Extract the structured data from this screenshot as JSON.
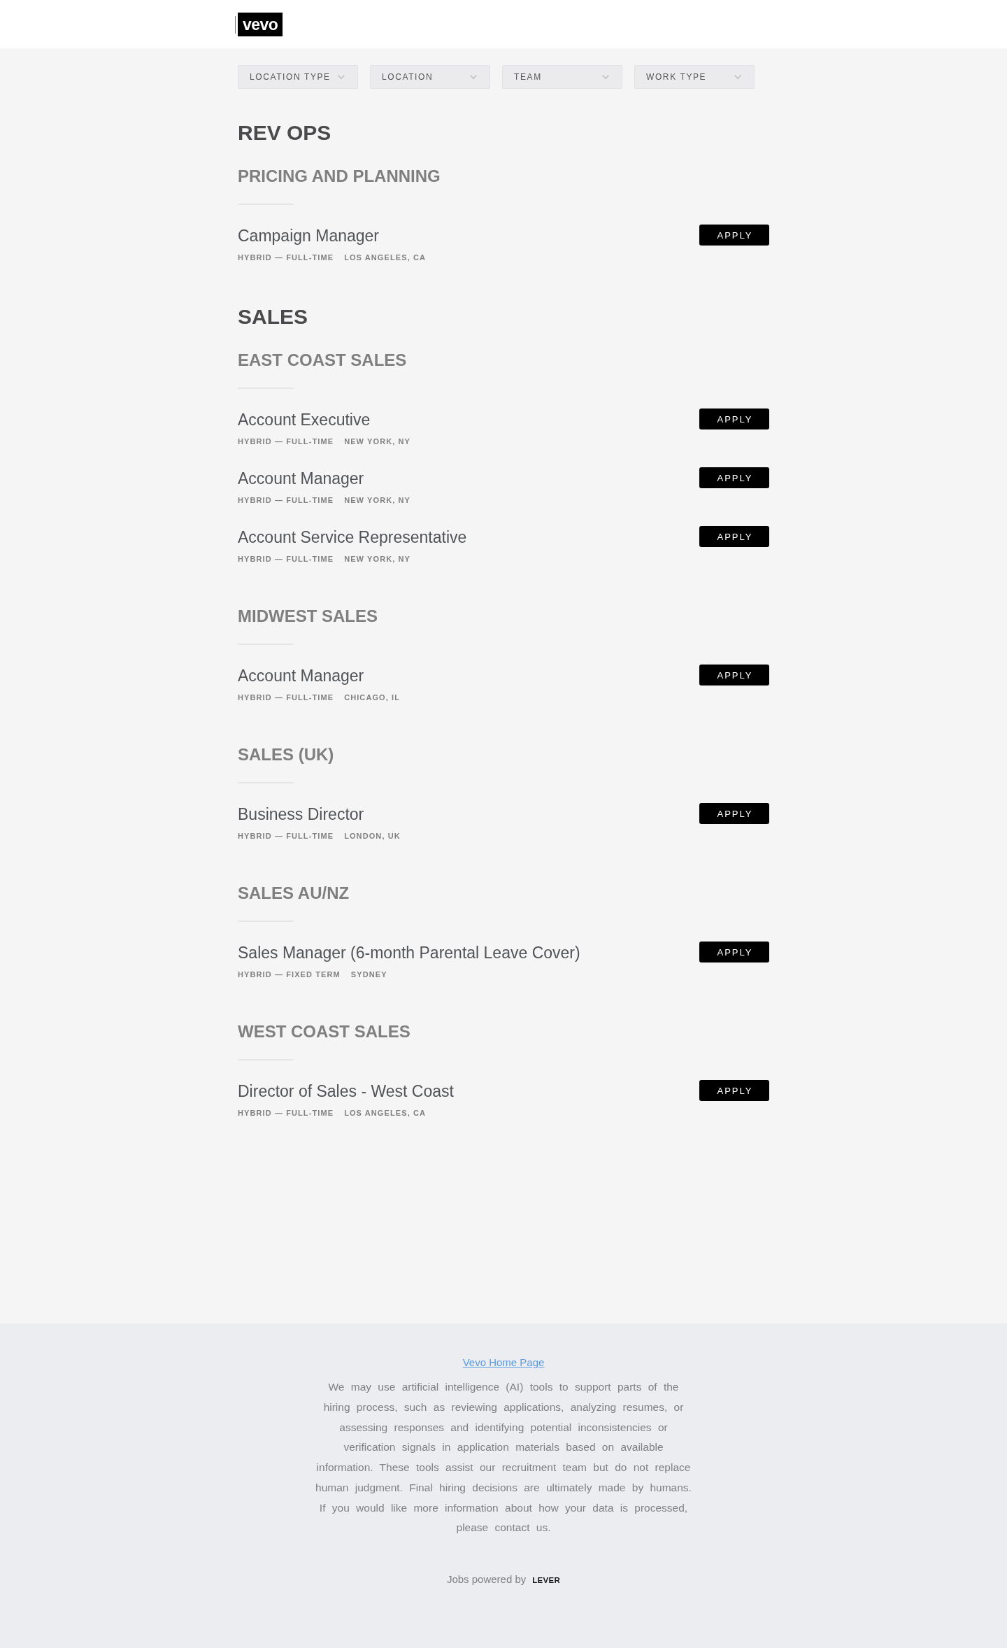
{
  "header": {
    "logo": "vevo"
  },
  "filters": [
    {
      "label": "LOCATION TYPE"
    },
    {
      "label": "LOCATION"
    },
    {
      "label": "TEAM"
    },
    {
      "label": "WORK TYPE"
    }
  ],
  "departments": [
    {
      "title": "REV OPS",
      "teams": [
        {
          "title": "PRICING AND PLANNING",
          "postings": [
            {
              "title": "Campaign Manager",
              "commitment": "HYBRID — FULL-TIME",
              "location": "LOS ANGELES, CA",
              "apply": "APPLY"
            }
          ]
        }
      ]
    },
    {
      "title": "SALES",
      "teams": [
        {
          "title": "EAST COAST SALES",
          "postings": [
            {
              "title": "Account Executive",
              "commitment": "HYBRID — FULL-TIME",
              "location": "NEW YORK, NY",
              "apply": "APPLY"
            },
            {
              "title": "Account Manager",
              "commitment": "HYBRID — FULL-TIME",
              "location": "NEW YORK, NY",
              "apply": "APPLY"
            },
            {
              "title": "Account Service Representative",
              "commitment": "HYBRID — FULL-TIME",
              "location": "NEW YORK, NY",
              "apply": "APPLY"
            }
          ]
        },
        {
          "title": "MIDWEST SALES",
          "postings": [
            {
              "title": "Account Manager",
              "commitment": "HYBRID — FULL-TIME",
              "location": "CHICAGO, IL",
              "apply": "APPLY"
            }
          ]
        },
        {
          "title": "SALES (UK)",
          "postings": [
            {
              "title": "Business Director",
              "commitment": "HYBRID — FULL-TIME",
              "location": "LONDON, UK",
              "apply": "APPLY"
            }
          ]
        },
        {
          "title": "SALES AU/NZ",
          "postings": [
            {
              "title": "Sales Manager (6-month Parental Leave Cover)",
              "commitment": "HYBRID — FIXED TERM",
              "location": "SYDNEY",
              "apply": "APPLY"
            }
          ]
        },
        {
          "title": "WEST COAST SALES",
          "postings": [
            {
              "title": "Director of Sales - West Coast",
              "commitment": "HYBRID — FULL-TIME",
              "location": "LOS ANGELES, CA",
              "apply": "APPLY"
            }
          ]
        }
      ]
    }
  ],
  "footer": {
    "link": "Vevo Home Page",
    "notice": "We may use artificial intelligence (AI) tools to support parts of the hiring process, such as reviewing applications, analyzing resumes, or assessing responses and identifying potential inconsistencies or verification signals in application materials based on available information. These tools assist our recruitment team but do not replace human judgment. Final hiring decisions are ultimately made by humans. If you would like more information about how your data is processed, please contact us.",
    "powered_by": "Jobs powered by",
    "logo": "LEVER"
  }
}
